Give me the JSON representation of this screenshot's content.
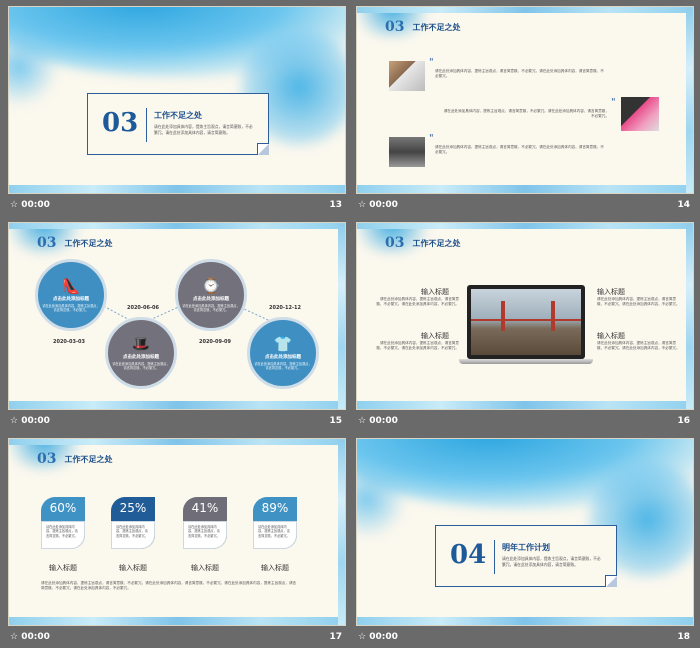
{
  "footer_time": "00:00",
  "footer_icon": "☆",
  "slides": [
    {
      "page": "13",
      "num": "03",
      "title": "工作不足之处",
      "desc": "请在此处添加具体内容，提炼主旨观点，请言简意赅，不必繁冗。请在此处添加具体内容，请言简意赅。"
    },
    {
      "page": "14",
      "num": "03",
      "title": "工作不足之处",
      "quote": "\"",
      "items": [
        "请在此处添加具体内容，提炼主旨观点，请言简意赅，不必繁冗。请在此处添加具体内容，请言简意赅，不必繁冗。",
        "请在此处添加具体内容，提炼主旨观点，请言简意赅，不必繁冗。请在此处添加具体内容，请言简意赅，不必繁冗。",
        "请在此处添加具体内容，提炼主旨观点，请言简意赅，不必繁冗。请在此处添加具体内容，请言简意赅，不必繁冗。"
      ]
    },
    {
      "page": "15",
      "num": "03",
      "title": "工作不足之处",
      "circle_title": "点击此处添加标题",
      "circle_desc": "请在此处添加具体内容，提炼主旨观点，请言简意赅，不必繁冗。",
      "dates": [
        "2020-06-06",
        "2020-12-12",
        "2020-03-03",
        "2020-09-09"
      ]
    },
    {
      "page": "16",
      "num": "03",
      "title": "工作不足之处",
      "label": "输入标题",
      "desc": "请在此处添加具体内容，提炼主旨观点，请言简意赅，不必繁冗。请在此处添加具体内容，不必繁冗。"
    },
    {
      "page": "17",
      "num": "03",
      "title": "工作不足之处",
      "cards": [
        {
          "pct": "60%",
          "color": "#3f93c4"
        },
        {
          "pct": "25%",
          "color": "#1f5c98"
        },
        {
          "pct": "41%",
          "color": "#6f6e78"
        },
        {
          "pct": "89%",
          "color": "#3f93c4"
        }
      ],
      "card_desc": "请在此处添加具体内容，提炼主旨观点，请言简意赅，不必繁冗。",
      "label": "输入标题",
      "bottom": "请在此处添加具体内容，提炼主旨观点，请言简意赅，不必繁冗。请在此处添加具体内容，请言简意赅，不必繁冗。请在此处添加具体内容，提炼主旨观点，请言简意赅，不必繁冗。请在此处添加具体内容，不必繁冗。"
    },
    {
      "page": "18",
      "num": "04",
      "title": "明年工作计划",
      "desc": "请在此处添加具体内容，提炼主旨观点，请言简意赅，不必繁冗。请在此处添加具体内容，请言简意赅。"
    }
  ]
}
